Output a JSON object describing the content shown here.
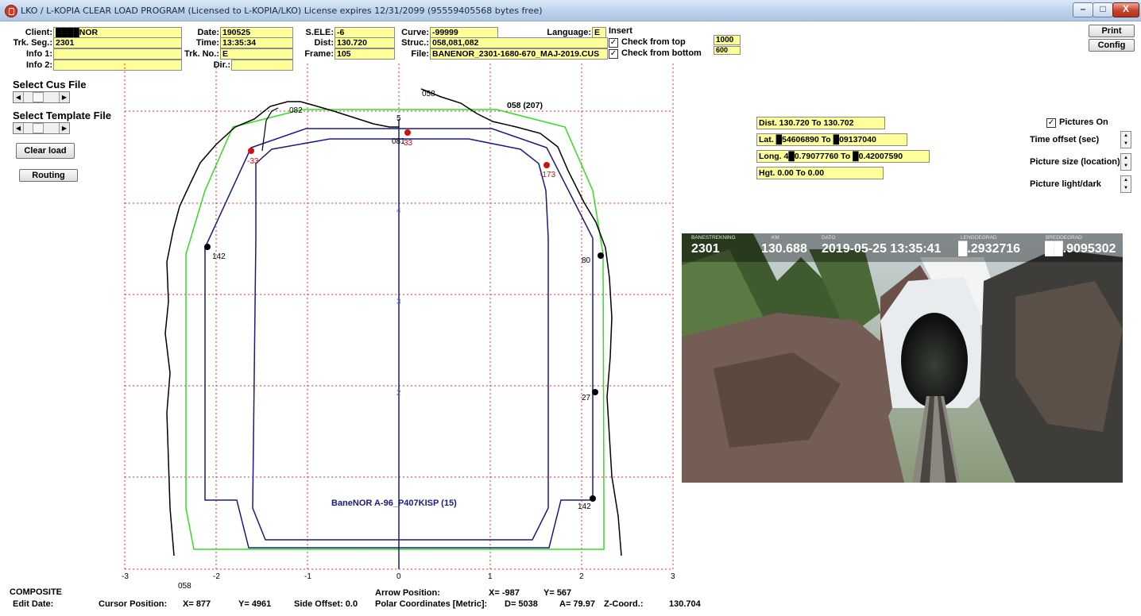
{
  "window": {
    "title": "LKO / L-KOPIA CLEAR LOAD PROGRAM   (Licensed to L-KOPIA/LKO)    License expires 12/31/2099    (95559405568 bytes free)",
    "minimize": "–",
    "maximize": "□",
    "close": "X"
  },
  "header": {
    "client_label": "Client:",
    "client_value": "████NOR",
    "trk_seg_label": "Trk. Seg.:",
    "trk_seg_value": "2301",
    "info1_label": "Info 1:",
    "info1_value": "",
    "info2_label": "Info 2:",
    "info2_value": "",
    "date_label": "Date:",
    "date_value": "190525",
    "time_label": "Time:",
    "time_value": "13:35:34",
    "trk_no_label": "Trk. No.:",
    "trk_no_value": "E",
    "dir_label": "Dir.:",
    "dir_value": "",
    "sele_label": "S.ELE:",
    "sele_value": "-6",
    "dist_label": "Dist:",
    "dist_value": "130.720",
    "frame_label": "Frame:",
    "frame_value": "105",
    "curve_label": "Curve:",
    "curve_value": "-99999",
    "struc_label": "Struc.:",
    "struc_value": "058,081,082",
    "file_label": "File:",
    "file_value": "BANENOR_2301-1680-670_MAJ-2019.CUS",
    "language_label": "Language:",
    "language_value": "E",
    "insert_label": "Insert",
    "check_top_label": "Check from top",
    "check_top_value": "1000",
    "check_bottom_label": "Check from bottom",
    "check_bottom_value": "600",
    "print_label": "Print",
    "config_label": "Config"
  },
  "left_panel": {
    "select_cus": "Select Cus File",
    "select_template": "Select Template File",
    "clear_load": "Clear load",
    "routing": "Routing"
  },
  "plot": {
    "x_ticks": [
      "-3",
      "-2",
      "-1",
      "0",
      "1",
      "2",
      "3"
    ],
    "y_ticks": [
      "5",
      "4",
      "3",
      "2"
    ],
    "labels": {
      "l082": "082",
      "l058top": "058",
      "l058_207": "058 (207)",
      "l081": "081",
      "r33a": "33",
      "r33b": "-33",
      "r173": "-173",
      "p142l": "142",
      "p80": "80",
      "p27": "27",
      "p142r": "142",
      "l058bot": "058",
      "template": "BaneNOR A-96_P407KISP  (15)"
    }
  },
  "right_panel": {
    "dist": "Dist. 130.720 To 130.702",
    "lat": "Lat. █54606890 To █09137040",
    "long": "Long. 4█0.79077760 To █0.42007590",
    "hgt": "Hgt. 0.00 To 0.00",
    "pictures_on": "Pictures On",
    "time_offset": "Time offset (sec)",
    "picture_size": "Picture size (location)",
    "picture_light": "Picture light/dark"
  },
  "photo_overlay": {
    "banestrekning_label": "BANESTREKNING",
    "banestrekning": "2301",
    "km_label": "KM",
    "km": "130.688",
    "dato_label": "DATO",
    "dato": "2019-05-25 13:35:41",
    "lengdegrad_label": "LENGDEGRAD",
    "lengdegrad": "█.2932716",
    "breddegrad_label": "BREDDEGRAD",
    "breddegrad": "██.9095302"
  },
  "status": {
    "composite": "COMPOSITE",
    "edit_date": "Edit Date:",
    "cursor_position": "Cursor Position:",
    "x": "X=  877",
    "y": "Y=  4961",
    "side_offset": "Side Offset:  0.0",
    "arrow_position": "Arrow Position:",
    "arrow_x": "X=  -987",
    "arrow_y": "Y=  567",
    "polar": "Polar Coordinates [Metric]:",
    "d": "D=  5038",
    "a": "A=  79.97",
    "zcoord_label": "Z-Coord.:",
    "zcoord_value": "130.704"
  },
  "colors": {
    "grid": "#e03030",
    "envelope": "#33dd22",
    "template": "#1a1a80",
    "field_bg": "#ffff99"
  }
}
